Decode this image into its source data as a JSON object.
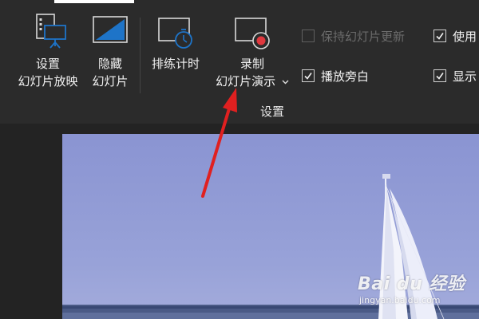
{
  "ribbon": {
    "buttons": {
      "setup_show": {
        "line1": "设置",
        "line2": "幻灯片放映"
      },
      "hide_slide": {
        "line1": "隐藏",
        "line2": "幻灯片"
      },
      "rehearse": {
        "label": "排练计时"
      },
      "record": {
        "line1": "录制",
        "line2": "幻灯片演示"
      }
    },
    "checkboxes": [
      {
        "label": "保持幻灯片更新",
        "checked": false,
        "enabled": false
      },
      {
        "label": "使用",
        "checked": true,
        "enabled": true
      },
      {
        "label": "播放旁白",
        "checked": true,
        "enabled": true
      },
      {
        "label": "显示",
        "checked": true,
        "enabled": true
      }
    ],
    "group_label": "设置"
  },
  "watermark": {
    "brand": "Bai du 经验",
    "site": "jingyan.baidu.com"
  },
  "colors": {
    "ribbon_bg": "#2b2b2b",
    "workspace_bg": "#232323",
    "record_dot": "#e0383e",
    "accent_icon": "#1e74c8",
    "sky": "#8e98d4",
    "annotation_arrow": "#e02020"
  },
  "icons": {
    "setup_show": "slideshow-setup-icon",
    "hide_slide": "hide-slide-icon",
    "rehearse": "rehearse-timings-icon",
    "record": "record-slideshow-icon",
    "dropdown": "chevron-down-icon"
  }
}
